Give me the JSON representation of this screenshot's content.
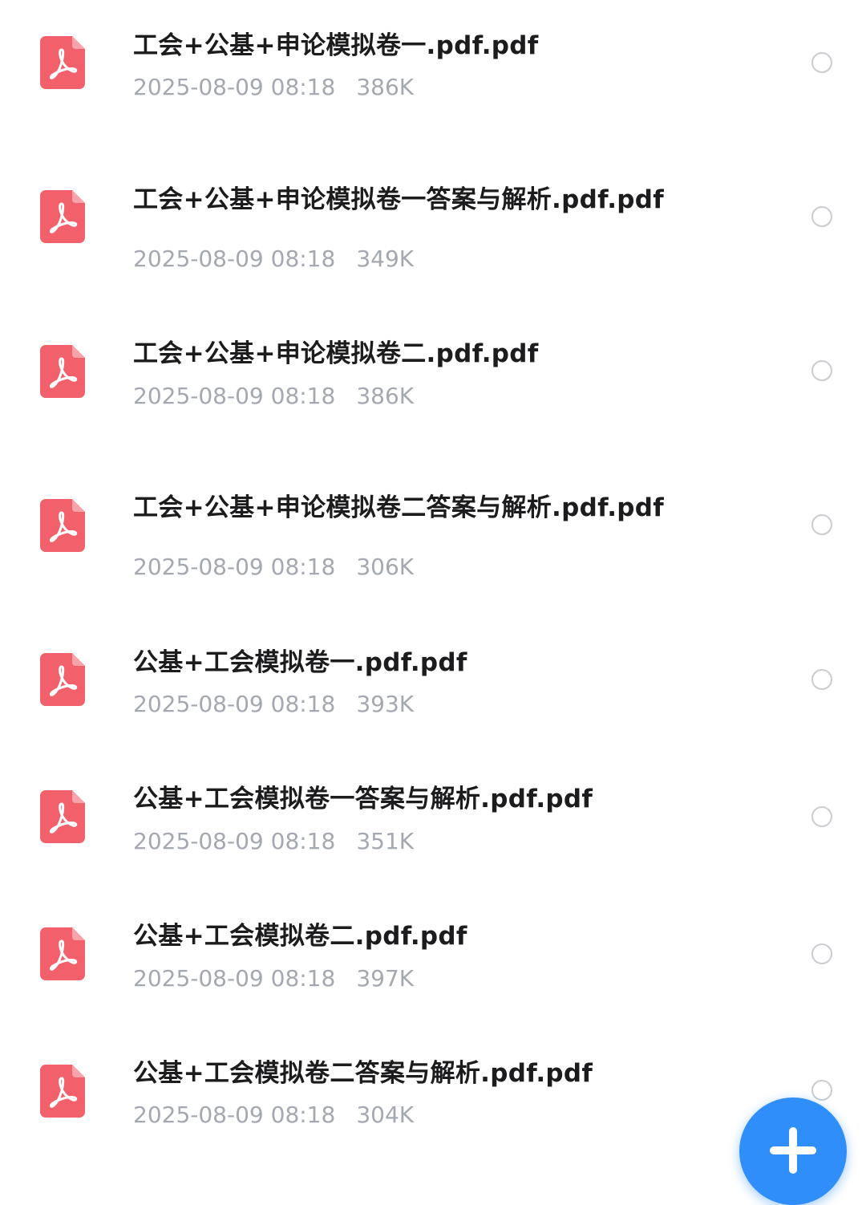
{
  "colors": {
    "pdf_icon": "#f2616b",
    "meta_text": "#a4a8b0",
    "fab": "#2f8ef9"
  },
  "files": [
    {
      "name": "工会+公基+申论模拟卷一.pdf.pdf",
      "date": "2025-08-09 08:18",
      "size": "386K",
      "icon": "pdf-icon"
    },
    {
      "name": "工会+公基+申论模拟卷一答案与解析.pdf.pdf",
      "date": "2025-08-09 08:18",
      "size": "349K",
      "icon": "pdf-icon"
    },
    {
      "name": "工会+公基+申论模拟卷二.pdf.pdf",
      "date": "2025-08-09 08:18",
      "size": "386K",
      "icon": "pdf-icon"
    },
    {
      "name": "工会+公基+申论模拟卷二答案与解析.pdf.pdf",
      "date": "2025-08-09 08:18",
      "size": "306K",
      "icon": "pdf-icon"
    },
    {
      "name": "公基+工会模拟卷一.pdf.pdf",
      "date": "2025-08-09 08:18",
      "size": "393K",
      "icon": "pdf-icon"
    },
    {
      "name": "公基+工会模拟卷一答案与解析.pdf.pdf",
      "date": "2025-08-09 08:18",
      "size": "351K",
      "icon": "pdf-icon"
    },
    {
      "name": "公基+工会模拟卷二.pdf.pdf",
      "date": "2025-08-09 08:18",
      "size": "397K",
      "icon": "pdf-icon"
    },
    {
      "name": "公基+工会模拟卷二答案与解析.pdf.pdf",
      "date": "2025-08-09 08:18",
      "size": "304K",
      "icon": "pdf-icon"
    }
  ],
  "fab": {
    "icon": "plus-icon"
  }
}
